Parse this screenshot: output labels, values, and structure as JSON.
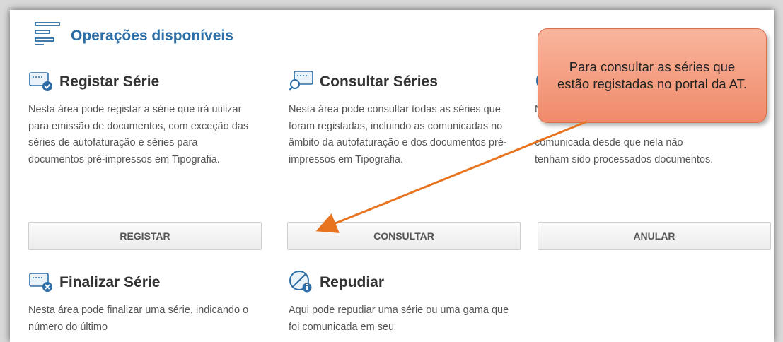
{
  "section": {
    "title": "Operações disponíveis"
  },
  "operations": [
    {
      "title": "Registar Série",
      "description": "Nesta área pode registar a série que irá utilizar para emissão de documentos, com exceção das séries de autofaturação e séries para documentos pré-impressos em Tipografia.",
      "button": "REGISTAR",
      "icon": "register-series-icon"
    },
    {
      "title": "Consultar Séries",
      "description": "Nesta área pode consultar todas as séries que foram registadas, incluindo as comunicadas no âmbito da autofaturação e dos documentos pré-impressos em Tipografia.",
      "button": "CONSULTAR",
      "icon": "consult-series-icon"
    },
    {
      "title_partial": "",
      "description_partial": "N                                         comunicada desde que nela não tenham sido processados documentos.",
      "button": "ANULAR",
      "icon": "cancel-series-icon"
    },
    {
      "title": "Finalizar Série",
      "description": "Nesta área pode finalizar uma série, indicando o número do último",
      "icon": "finalize-series-icon"
    },
    {
      "title": "Repudiar",
      "description": "Aqui pode repudiar uma série ou uma gama que foi comunicada em seu",
      "icon": "repudiate-icon"
    }
  ],
  "callout": {
    "text": "Para consultar as séries que estão registadas no portal da AT."
  },
  "colors": {
    "accent": "#2e6ea6",
    "callout_fill": "#f4a084",
    "arrow": "#e8741f"
  }
}
